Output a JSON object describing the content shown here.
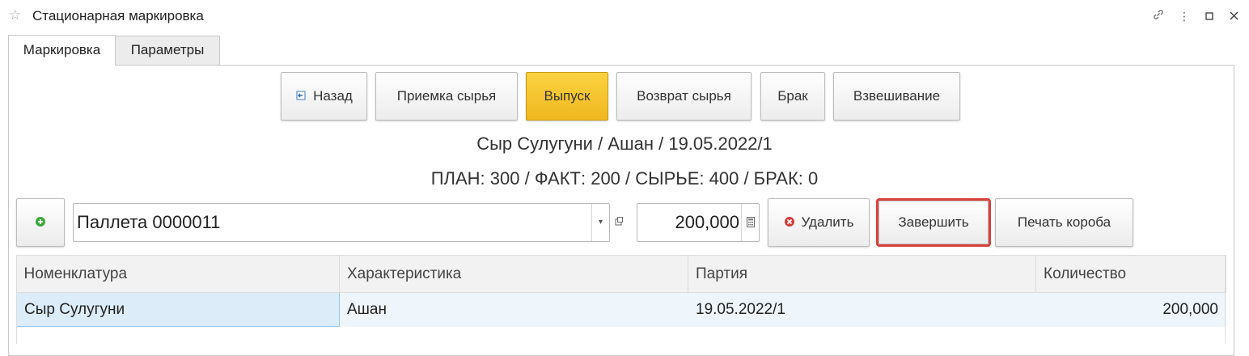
{
  "window": {
    "title": "Стационарная маркировка",
    "icons": [
      "star-icon",
      "link-icon",
      "more-icon",
      "maximize-icon",
      "close-icon"
    ]
  },
  "tabs": [
    {
      "label": "Маркировка",
      "active": true
    },
    {
      "label": "Параметры",
      "active": false
    }
  ],
  "toolbar": {
    "back_label": "Назад",
    "intake_label": "Приемка сырья",
    "release_label": "Выпуск",
    "return_label": "Возврат сырья",
    "defect_label": "Брак",
    "weighing_label": "Взвешивание"
  },
  "product_line": "Сыр Сулугуни / Ашан / 19.05.2022/1",
  "stats_line": "ПЛАН: 300 / ФАКТ: 200 / СЫРЬЕ: 400 / БРАК: 0",
  "pallet": {
    "value": "Паллета 0000011",
    "quantity": "200,000"
  },
  "actions": {
    "delete_label": "Удалить",
    "finish_label": "Завершить",
    "print_box_label": "Печать короба"
  },
  "table": {
    "columns": [
      "Номенклатура",
      "Характеристика",
      "Партия",
      "Количество"
    ],
    "rows": [
      [
        "Сыр Сулугуни",
        "Ашан",
        "19.05.2022/1",
        "200,000"
      ]
    ]
  },
  "colors": {
    "accent_yellow": "#f5c42c",
    "focus_red": "#d9413c",
    "add_green": "#3aa83a",
    "delete_red": "#d23c3c"
  }
}
